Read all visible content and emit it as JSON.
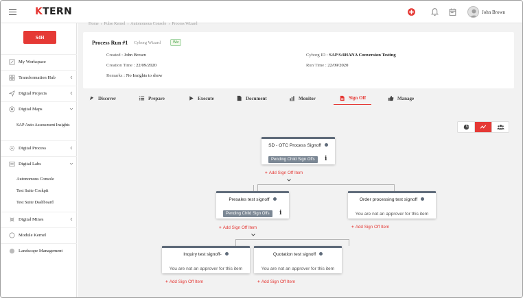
{
  "header": {
    "logo": "KTERN",
    "logo_accent": "K",
    "logo_rest": "TERN",
    "user_name": "John Brown"
  },
  "sidebar": {
    "top_button": "S4H",
    "items": [
      {
        "label": "My Workspace",
        "icon": "home-icon"
      },
      {
        "label": "Transformation Hub",
        "icon": "grid-icon",
        "expanded": false
      },
      {
        "label": "Digital Projects",
        "icon": "send-icon",
        "expanded": false
      },
      {
        "label": "Digital Maps",
        "icon": "map-icon",
        "expanded": true
      },
      {
        "label": "Digital Process",
        "icon": "process-icon",
        "expanded": false
      },
      {
        "label": "Digital Labs",
        "icon": "labs-icon",
        "expanded": true
      },
      {
        "label": "Digital Mines",
        "icon": "mines-icon",
        "expanded": false
      },
      {
        "label": "Module Kernel",
        "icon": "kernel-icon"
      },
      {
        "label": "Landscape Management",
        "icon": "landscape-icon"
      }
    ],
    "maps_sub": [
      "SAP Auto Assessment Insights"
    ],
    "labs_sub": [
      "Autonomous Console",
      "Test Suite Cockpit",
      "Test Suite Dashboard"
    ]
  },
  "breadcrumb": [
    "Home",
    "Pulse Kernel",
    "Autonomous Console",
    "Process Wizard"
  ],
  "process": {
    "title": "Process Run #1",
    "subtitle": "Cyborg Wizard",
    "badge": "Wiz",
    "created_label": "Created :",
    "created_value": "John Brown",
    "creation_time_label": "Creation Time :",
    "creation_time_value": "22/09/2020",
    "remarks_label": "Remarks :",
    "remarks_value": "No Insights to show",
    "cyborg_id_label": "Cyborg ID :",
    "cyborg_id_value": "SAP S/4HANA Conversion Testing",
    "run_time_label": "Run Time :",
    "run_time_value": "22/09/2020"
  },
  "tabs": [
    {
      "label": "Discover",
      "icon": "compass-icon"
    },
    {
      "label": "Prepare",
      "icon": "list-icon"
    },
    {
      "label": "Execute",
      "icon": "play-icon"
    },
    {
      "label": "Document",
      "icon": "document-icon"
    },
    {
      "label": "Monitor",
      "icon": "chart-icon"
    },
    {
      "label": "Sign Off",
      "icon": "signoff-icon",
      "active": true
    },
    {
      "label": "Manage",
      "icon": "thumbs-up-icon"
    }
  ],
  "view_toggle": [
    "pie-chart-icon",
    "trend-icon",
    "users-icon"
  ],
  "tree": {
    "root": {
      "title": "SD - OTC Process Signoff",
      "status": "Pending Child Sign Offs",
      "add": "Add Sign Off Item"
    },
    "presales": {
      "title": "Presales test signoff",
      "status": "Pending Child Sign Offs",
      "add": "Add Sign Off Item"
    },
    "order": {
      "title": "Order processing test signoff",
      "note": "You are not an approver for this item",
      "add": "Add Sign Off Item"
    },
    "inquiry": {
      "title": "Inquiry test signoff-",
      "note": "You are not an approver for this item",
      "add": "Add Sign Off Item"
    },
    "quotation": {
      "title": "Quotation test signoff",
      "note": "You are not an approver for this item",
      "add": "Add Sign Off Item"
    }
  },
  "colors": {
    "accent": "#e53935",
    "node_header": "#5f6b7a",
    "pending": "#7b8794"
  }
}
